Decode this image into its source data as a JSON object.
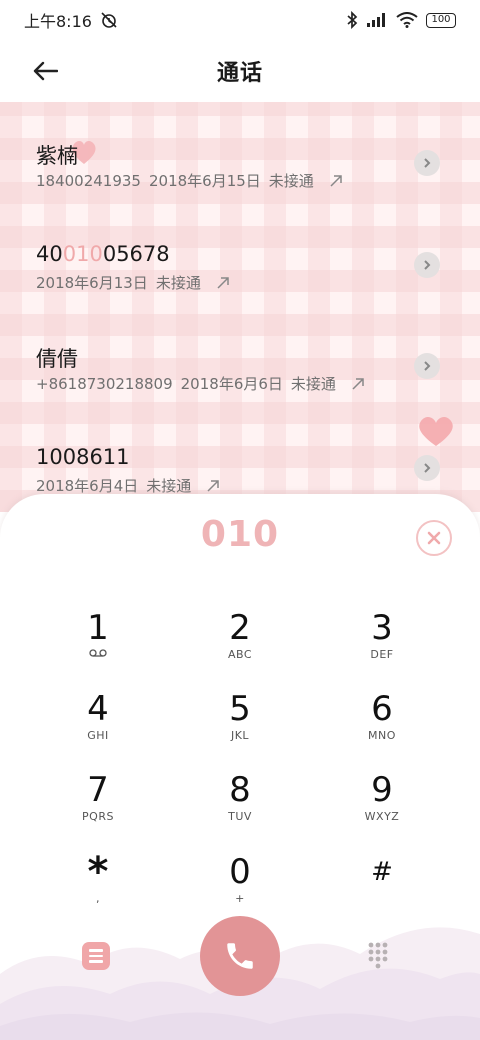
{
  "status_bar": {
    "time": "上午8:16",
    "battery": "100"
  },
  "header": {
    "title": "通话"
  },
  "calls": [
    {
      "name_prefix": "紫楠",
      "name_highlight": "",
      "name_suffix": "",
      "number": "18400241935",
      "date": "2018年6月15日",
      "status": "未接通"
    },
    {
      "name_prefix": "40",
      "name_highlight": "010",
      "name_suffix": "05678",
      "number": "",
      "date": "2018年6月13日",
      "status": "未接通"
    },
    {
      "name_prefix": "倩倩",
      "name_highlight": "",
      "name_suffix": "",
      "number": "+8618730218809",
      "date": "2018年6月6日",
      "status": "未接通"
    },
    {
      "name_prefix": "1008611",
      "name_highlight": "",
      "name_suffix": "",
      "number": "",
      "date": "2018年6月4日",
      "status": "未接通"
    }
  ],
  "dialpad": {
    "input": "010",
    "keys": [
      {
        "digit": "1",
        "letters": ""
      },
      {
        "digit": "2",
        "letters": "ABC"
      },
      {
        "digit": "3",
        "letters": "DEF"
      },
      {
        "digit": "4",
        "letters": "GHI"
      },
      {
        "digit": "5",
        "letters": "JKL"
      },
      {
        "digit": "6",
        "letters": "MNO"
      },
      {
        "digit": "7",
        "letters": "PQRS"
      },
      {
        "digit": "8",
        "letters": "TUV"
      },
      {
        "digit": "9",
        "letters": "WXYZ"
      },
      {
        "digit": "*",
        "letters": ","
      },
      {
        "digit": "0",
        "letters": "+"
      },
      {
        "digit": "#",
        "letters": ""
      }
    ]
  },
  "icons": {
    "back": "back-arrow-icon",
    "detail": "chevron-right-icon",
    "outgoing": "outgoing-arrow-icon",
    "clear": "close-icon",
    "call": "phone-icon",
    "menu": "menu-icon",
    "keypad": "keypad-grid-icon",
    "voicemail": "voicemail-icon"
  },
  "colors": {
    "accent_pink": "#efb4b6",
    "call_button": "#e29496",
    "highlight": "#f0a9aa"
  }
}
